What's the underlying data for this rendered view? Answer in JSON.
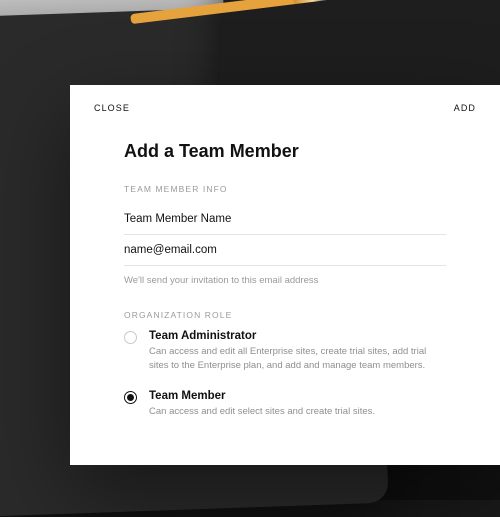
{
  "header": {
    "close_label": "CLOSE",
    "add_label": "ADD"
  },
  "title": "Add a Team Member",
  "sections": {
    "info_label": "TEAM MEMBER INFO",
    "role_label": "ORGANIZATION ROLE"
  },
  "fields": {
    "name_placeholder": "Team Member Name",
    "email_placeholder": "name@email.com",
    "email_helper": "We'll send your invitation to this email address"
  },
  "roles": {
    "admin": {
      "title": "Team Administrator",
      "desc": "Can access and edit all Enterprise sites, create trial sites, add trial sites to the Enterprise plan, and add and manage team members.",
      "selected": false
    },
    "member": {
      "title": "Team Member",
      "desc": "Can access and edit select sites and create trial sites.",
      "selected": true
    }
  }
}
